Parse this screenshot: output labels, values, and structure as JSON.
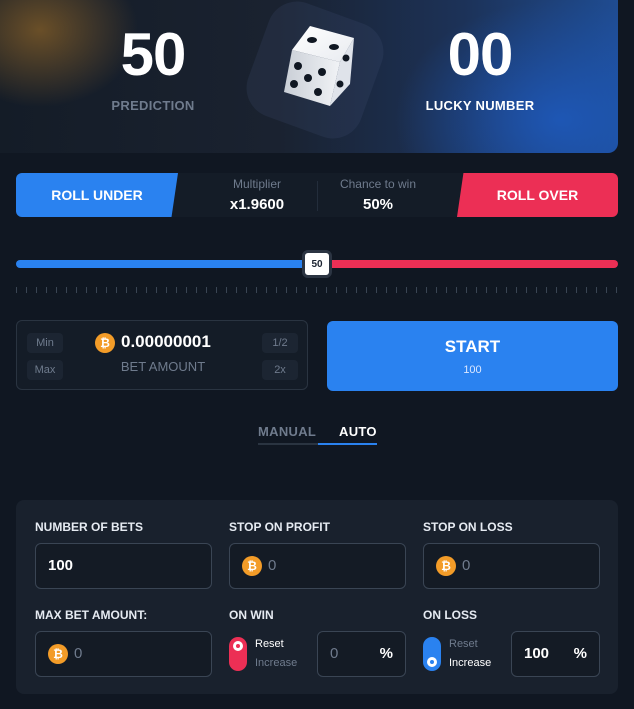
{
  "hero": {
    "prediction_value": "50",
    "prediction_label": "PREDICTION",
    "lucky_value": "00",
    "lucky_label": "LUCKY NUMBER"
  },
  "roll": {
    "under_label": "ROLL UNDER",
    "over_label": "ROLL OVER",
    "multiplier_label": "Multiplier",
    "multiplier_value": "x1.9600",
    "chance_label": "Chance to win",
    "chance_value": "50%"
  },
  "slider": {
    "value": 50,
    "min": 0,
    "max": 100,
    "thumb_label": "50"
  },
  "bet": {
    "min_label": "Min",
    "max_label": "Max",
    "half_label": "1/2",
    "double_label": "2x",
    "amount": "0.00000001",
    "amount_label": "BET AMOUNT",
    "currency_icon": "bitcoin-icon"
  },
  "start": {
    "label": "START",
    "count": "100"
  },
  "tabs": {
    "manual": "MANUAL",
    "auto": "AUTO",
    "active": "auto"
  },
  "auto": {
    "number_of_bets_label": "NUMBER OF BETS",
    "number_of_bets_value": "100",
    "stop_on_profit_label": "STOP ON PROFIT",
    "stop_on_profit_value": "0",
    "stop_on_loss_label": "STOP ON LOSS",
    "stop_on_loss_value": "0",
    "max_bet_label": "MAX BET AMOUNT:",
    "max_bet_value": "0",
    "on_win_label": "ON WIN",
    "on_win_reset": "Reset",
    "on_win_increase": "Increase",
    "on_win_mode": "reset",
    "on_win_value": "0",
    "on_loss_label": "ON LOSS",
    "on_loss_reset": "Reset",
    "on_loss_increase": "Increase",
    "on_loss_mode": "increase",
    "on_loss_value": "100",
    "percent_symbol": "%"
  },
  "colors": {
    "blue": "#2a82f0",
    "red": "#ec2f55",
    "bitcoin": "#f39c28",
    "background": "#101722"
  }
}
